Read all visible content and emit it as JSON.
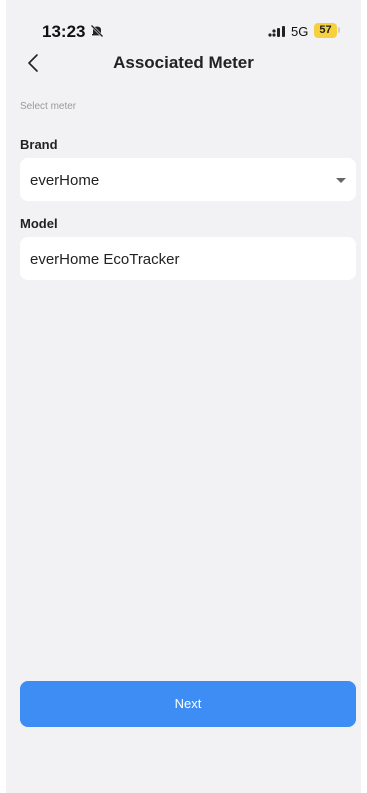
{
  "status_bar": {
    "time": "13:23",
    "network": "5G",
    "battery": "57"
  },
  "header": {
    "title": "Associated Meter"
  },
  "form": {
    "section_label": "Select meter",
    "brand": {
      "label": "Brand",
      "value": "everHome"
    },
    "model": {
      "label": "Model",
      "value": "everHome EcoTracker"
    }
  },
  "footer": {
    "next_label": "Next"
  },
  "colors": {
    "accent": "#3d8df5",
    "background": "#f2f2f4",
    "battery": "#f7d13d"
  },
  "icons": [
    "bell-muted-icon",
    "signal-icon",
    "back-chevron-icon",
    "dropdown-caret-icon"
  ]
}
